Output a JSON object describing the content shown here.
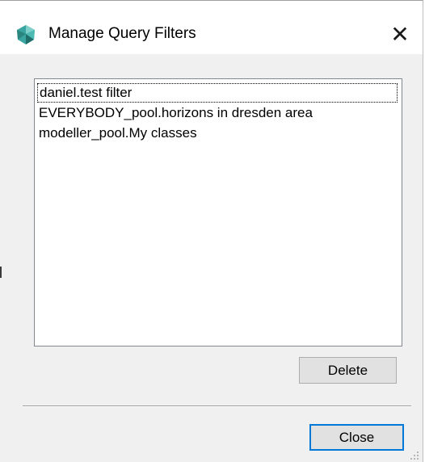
{
  "window": {
    "title": "Manage Query Filters",
    "close_glyph": "✕",
    "app_icon": "app-logo-icon"
  },
  "filters": {
    "items": [
      {
        "label": "daniel.test filter",
        "focused": true
      },
      {
        "label": "EVERYBODY_pool.horizons in dresden area",
        "focused": false
      },
      {
        "label": "modeller_pool.My classes",
        "focused": false
      }
    ]
  },
  "buttons": {
    "delete_label": "Delete",
    "close_label": "Close"
  },
  "colors": {
    "dialog_bg": "#f0f0f0",
    "titlebar_bg": "#ffffff",
    "default_button_border": "#0078d7",
    "icon_teal": "#3aa5a0"
  }
}
